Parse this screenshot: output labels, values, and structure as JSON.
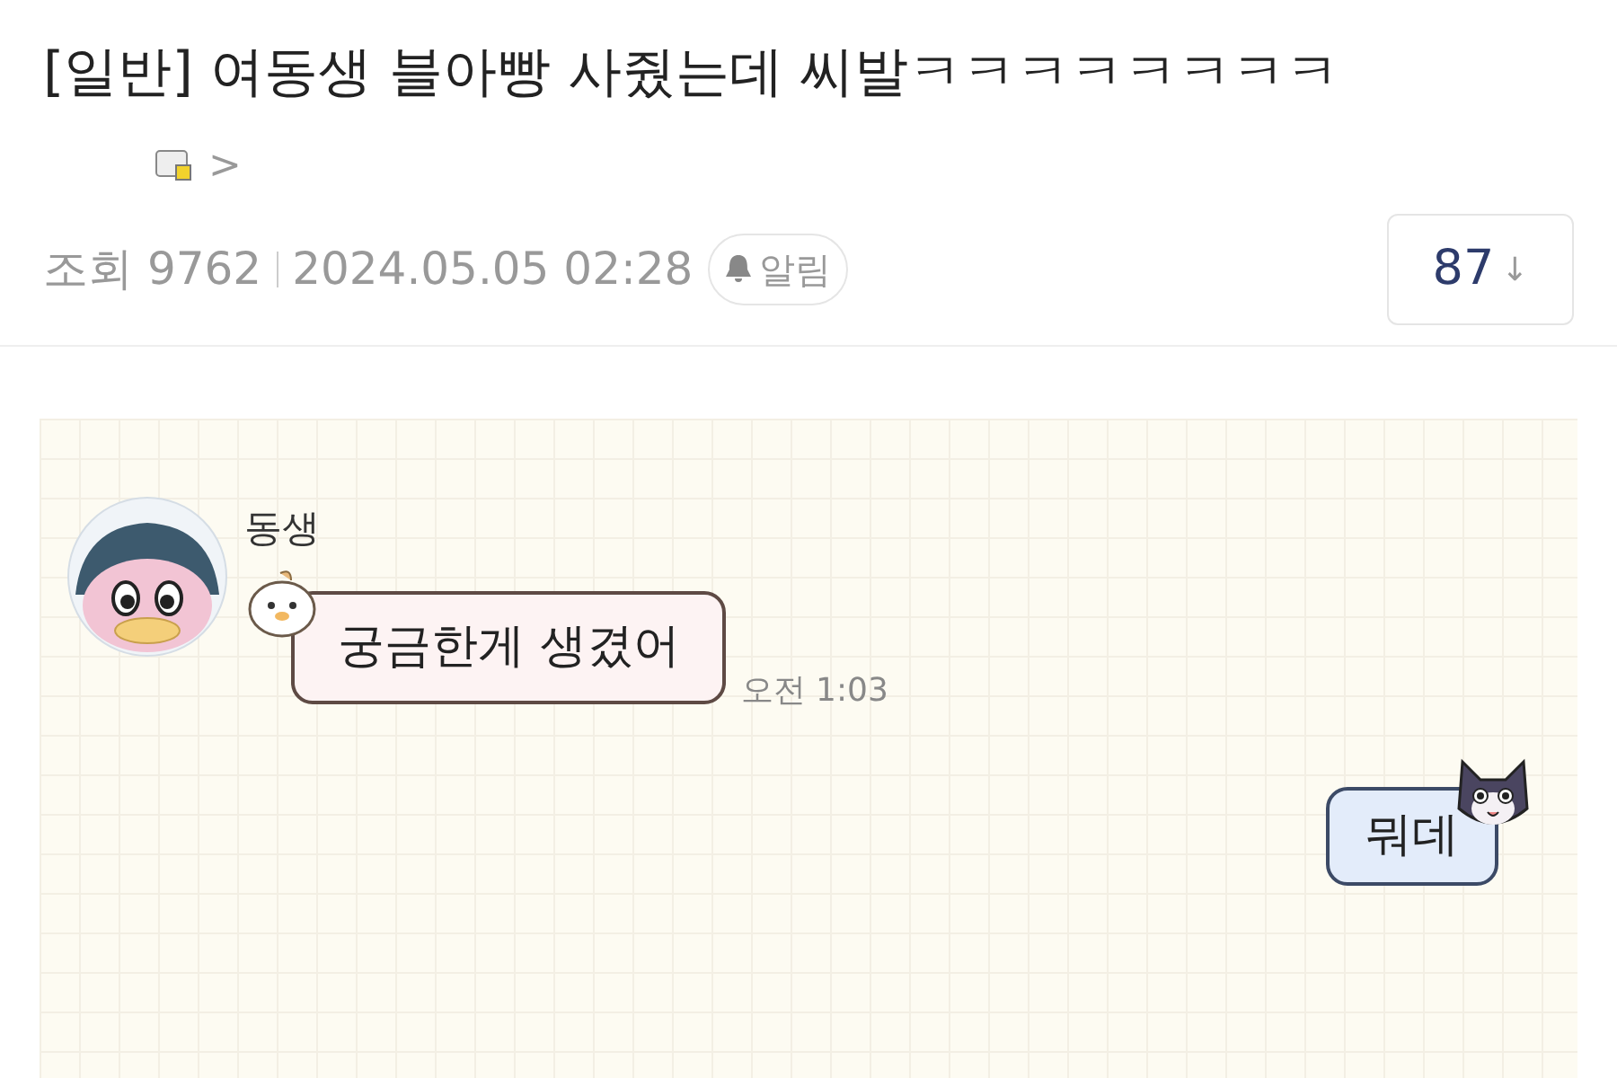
{
  "post": {
    "category": "[일반]",
    "title": "여동생 블아빵 사줬는데 씨발ㅋㅋㅋㅋㅋㅋㅋㅋ",
    "arrow": ">",
    "views_label": "조회",
    "views": "9762",
    "date": "2024.05.05 02:28",
    "alarm": "알림",
    "comments": "87",
    "comments_arrow": "↓"
  },
  "chat": {
    "sender": "동생",
    "messages": [
      {
        "kind": "received",
        "text": "궁금한게 생겼어",
        "time": "오전 1:03"
      },
      {
        "kind": "sent",
        "text": "뭐데"
      }
    ]
  }
}
